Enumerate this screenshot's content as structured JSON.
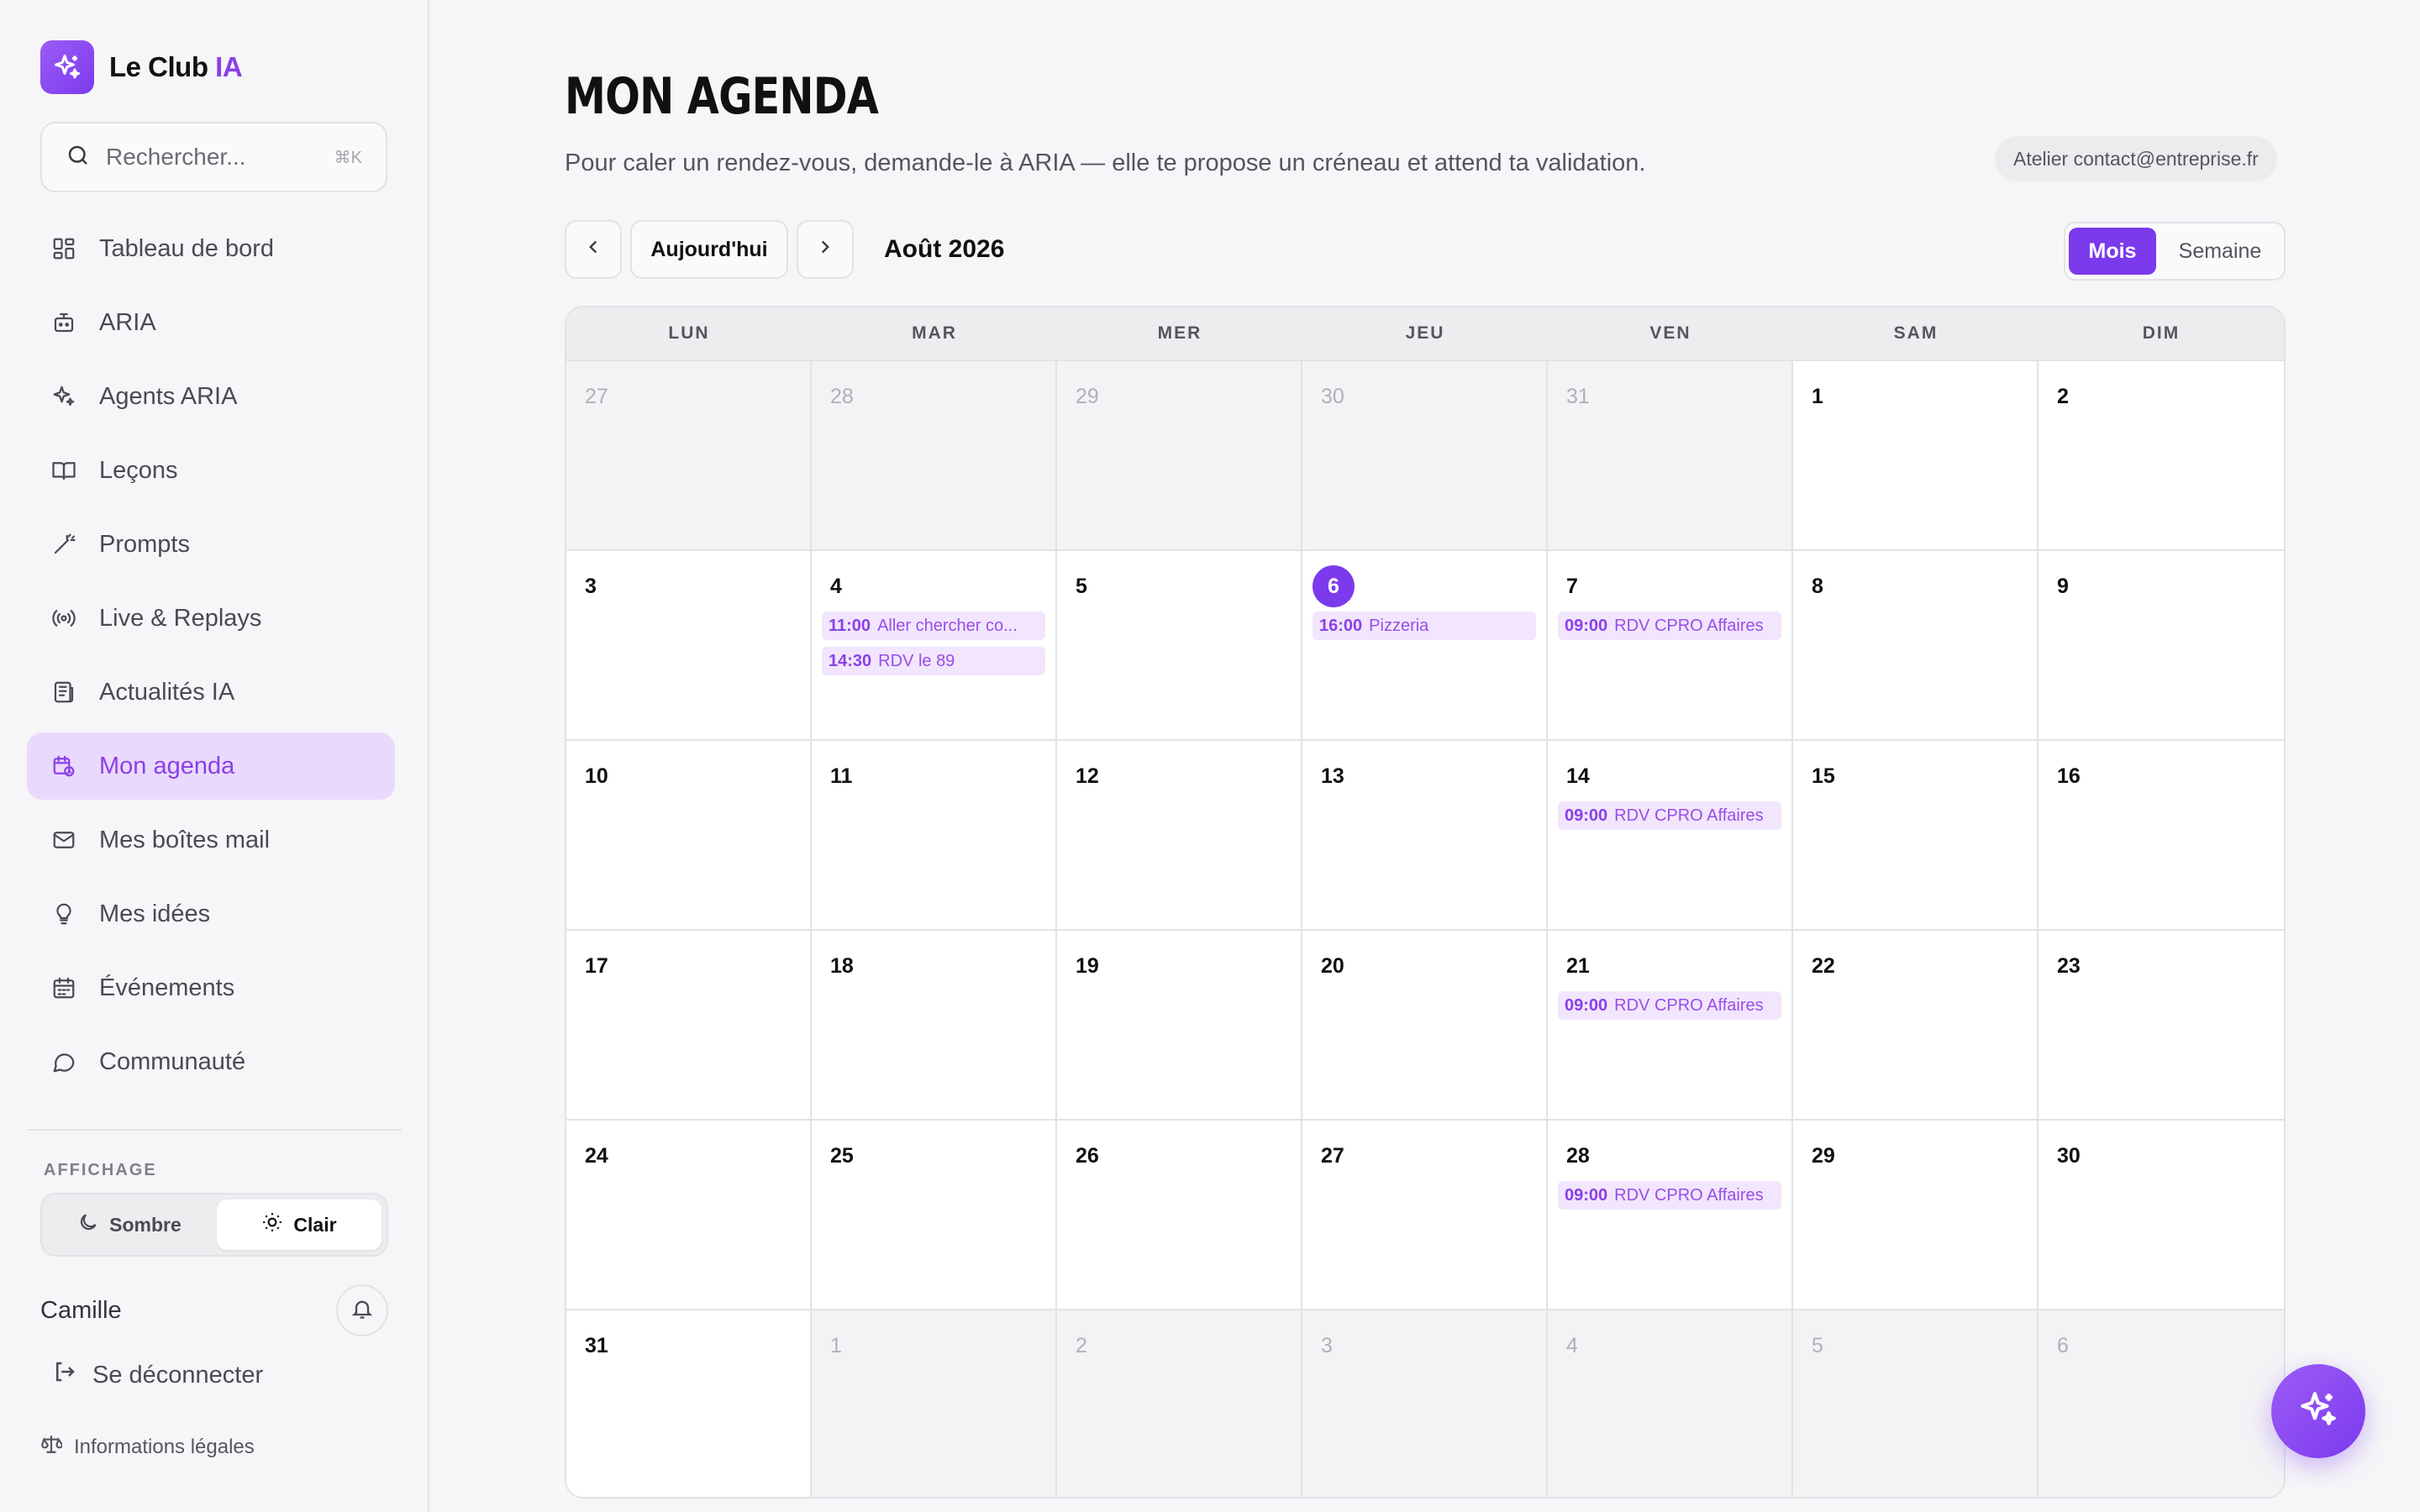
{
  "brand": {
    "name": "Le Club ",
    "accent": "IA"
  },
  "search": {
    "placeholder": "Rechercher...",
    "shortcut": "⌘K"
  },
  "nav": [
    {
      "label": "Tableau de bord",
      "icon": "dashboard-icon"
    },
    {
      "label": "ARIA",
      "icon": "bot-icon"
    },
    {
      "label": "Agents ARIA",
      "icon": "sparkles-icon"
    },
    {
      "label": "Leçons",
      "icon": "book-icon"
    },
    {
      "label": "Prompts",
      "icon": "magic-wand-icon"
    },
    {
      "label": "Live & Replays",
      "icon": "broadcast-icon"
    },
    {
      "label": "Actualités IA",
      "icon": "newspaper-icon"
    },
    {
      "label": "Mon agenda",
      "icon": "calendar-clock-icon",
      "active": true
    },
    {
      "label": "Mes boîtes mail",
      "icon": "mail-icon"
    },
    {
      "label": "Mes idées",
      "icon": "lightbulb-icon"
    },
    {
      "label": "Événements",
      "icon": "calendar-icon"
    },
    {
      "label": "Communauté",
      "icon": "chat-bubble-icon"
    }
  ],
  "display": {
    "section_label": "AFFICHAGE",
    "dark_label": "Sombre",
    "light_label": "Clair",
    "selected": "light"
  },
  "user": {
    "name": "Camille"
  },
  "logout_label": "Se déconnecter",
  "legal_label": "Informations légales",
  "page": {
    "title": "MON AGENDA",
    "subtitle": "Pour caler un rendez-vous, demande-le à ARIA — elle te propose un créneau et attend ta validation.",
    "workshop_chip": "Atelier contact@entreprise.fr"
  },
  "toolbar": {
    "today_label": "Aujourd'hui",
    "month_label": "Août 2026",
    "view_month": "Mois",
    "view_week": "Semaine",
    "active_view": "month"
  },
  "calendar": {
    "weekdays": [
      "LUN",
      "MAR",
      "MER",
      "JEU",
      "VEN",
      "SAM",
      "DIM"
    ],
    "days": [
      {
        "n": "27",
        "other": true
      },
      {
        "n": "28",
        "other": true
      },
      {
        "n": "29",
        "other": true
      },
      {
        "n": "30",
        "other": true
      },
      {
        "n": "31",
        "other": true
      },
      {
        "n": "1"
      },
      {
        "n": "2"
      },
      {
        "n": "3"
      },
      {
        "n": "4",
        "events": [
          {
            "time": "11:00",
            "title": "Aller chercher co..."
          },
          {
            "time": "14:30",
            "title": "RDV le 89"
          }
        ]
      },
      {
        "n": "5"
      },
      {
        "n": "6",
        "today": true,
        "events": [
          {
            "time": "16:00",
            "title": "Pizzeria"
          }
        ]
      },
      {
        "n": "7",
        "events": [
          {
            "time": "09:00",
            "title": "RDV CPRO Affaires"
          }
        ]
      },
      {
        "n": "8"
      },
      {
        "n": "9"
      },
      {
        "n": "10"
      },
      {
        "n": "11"
      },
      {
        "n": "12"
      },
      {
        "n": "13"
      },
      {
        "n": "14",
        "events": [
          {
            "time": "09:00",
            "title": "RDV CPRO Affaires"
          }
        ]
      },
      {
        "n": "15"
      },
      {
        "n": "16"
      },
      {
        "n": "17"
      },
      {
        "n": "18"
      },
      {
        "n": "19"
      },
      {
        "n": "20"
      },
      {
        "n": "21",
        "events": [
          {
            "time": "09:00",
            "title": "RDV CPRO Affaires"
          }
        ]
      },
      {
        "n": "22"
      },
      {
        "n": "23"
      },
      {
        "n": "24"
      },
      {
        "n": "25"
      },
      {
        "n": "26"
      },
      {
        "n": "27"
      },
      {
        "n": "28",
        "events": [
          {
            "time": "09:00",
            "title": "RDV CPRO Affaires"
          }
        ]
      },
      {
        "n": "29"
      },
      {
        "n": "30"
      },
      {
        "n": "31"
      },
      {
        "n": "1",
        "other": true
      },
      {
        "n": "2",
        "other": true
      },
      {
        "n": "3",
        "other": true
      },
      {
        "n": "4",
        "other": true
      },
      {
        "n": "5",
        "other": true
      },
      {
        "n": "6",
        "other": true
      }
    ]
  },
  "colors": {
    "accent": "#7c3aed",
    "accent_soft": "#e9dafd",
    "event_bg": "#f1e6fd"
  }
}
